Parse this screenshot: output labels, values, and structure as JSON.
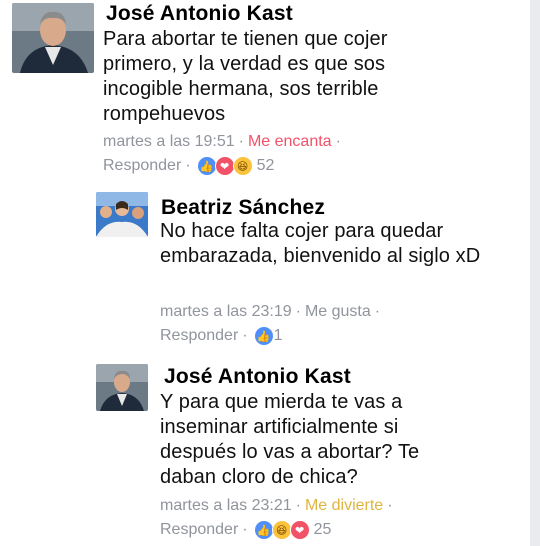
{
  "comments": [
    {
      "author": "José Antonio Kast",
      "text": "Para abortar te tienen que cojer primero, y la verdad es que sos incogible hermana, sos terrible rompehuevos",
      "time": "martes a las 19:51",
      "reaction_label": "Me encanta",
      "reaction_color": "#f25268",
      "reply_label": "Responder",
      "reaction_icons": [
        "like-icon",
        "love-icon",
        "haha-icon"
      ],
      "count": "52"
    },
    {
      "author": "Beatriz Sánchez",
      "text": "No hace falta cojer para quedar embarazada, bienvenido al siglo xD",
      "time": "martes a las 23:19",
      "reaction_label": "Me gusta",
      "reaction_color": "#90949c",
      "reply_label": "Responder",
      "reaction_icons": [
        "like-icon"
      ],
      "count": "1"
    },
    {
      "author": "José Antonio Kast",
      "text": "Y para que mierda te vas a inseminar artificialmente si después lo vas a abortar? Te daban cloro de chica?",
      "time": "martes a las 23:21",
      "reaction_label": "Me divierte",
      "reaction_color": "#f7c55a",
      "reply_label": "Responder",
      "reaction_icons": [
        "like-icon",
        "haha-icon",
        "love-icon"
      ],
      "count": "25"
    }
  ],
  "separator": "·"
}
